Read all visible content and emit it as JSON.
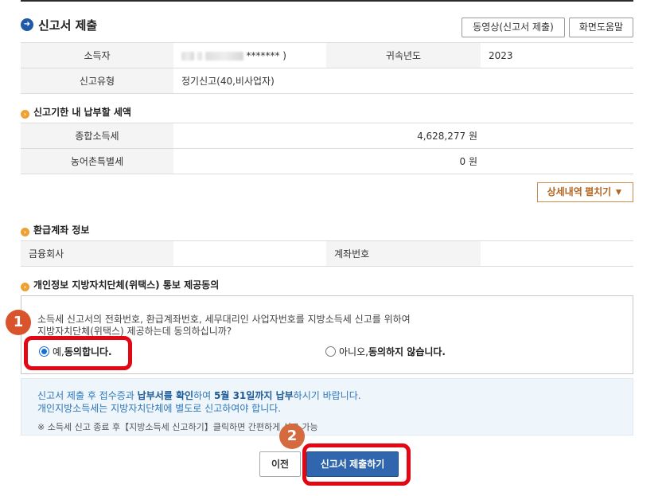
{
  "header": {
    "title": "신고서 제출",
    "video_button": "동영상(신고서 제출)",
    "help_button": "화면도움말"
  },
  "taxpayer_table": {
    "income_earner_label": "소득자",
    "income_earner_value": "*******  )",
    "tax_year_label": "귀속년도",
    "tax_year_value": "2023",
    "filing_type_label": "신고유형",
    "filing_type_value": "정기신고(40,비사업자)"
  },
  "tax_section": {
    "title": "신고기한 내 납부할 세액",
    "rows": [
      {
        "label": "종합소득세",
        "value": "4,628,277 원"
      },
      {
        "label": "농어촌특별세",
        "value": "0 원"
      }
    ],
    "detail_button": "상세내역 펼치기 ▼"
  },
  "refund_section": {
    "title": "환급계좌 정보",
    "bank_label": "금융회사",
    "bank_value": "",
    "account_label": "계좌번호",
    "account_value": ""
  },
  "consent_section": {
    "title": "개인정보 지방자치단체(위택스) 통보 제공동의",
    "text_line1": "소득세 신고서의 전화번호, 환급계좌번호, 세무대리인 사업자번호를 지방소득세 신고를 위하여",
    "text_line2": "지방자치단체(위택스) 제공하는데 동의하십니까?",
    "yes_prefix": "예,",
    "yes_label": " 동의합니다.",
    "no_prefix": "아니오,",
    "no_label": " 동의하지 않습니다.",
    "selected": "yes"
  },
  "info_box": {
    "line1_a": "신고서 제출 후 접수증과 ",
    "line1_b": "납부서를 확인",
    "line1_c": "하여 ",
    "line1_d": "5월 31일까지 납부",
    "line1_e": "하시기 바랍니다.",
    "line2": "개인지방소득세는 지방자치단체에 별도로 신고하여야 합니다.",
    "line3": "※ 소득세 신고 종료 후【지방소득세 신고하기】클릭하면 간편하게 신고 가능"
  },
  "footer": {
    "prev_button": "이전",
    "submit_button": "신고서 제출하기"
  },
  "annotations": {
    "badge1": "1",
    "badge2": "2",
    "highlight_color": "#e30613"
  }
}
